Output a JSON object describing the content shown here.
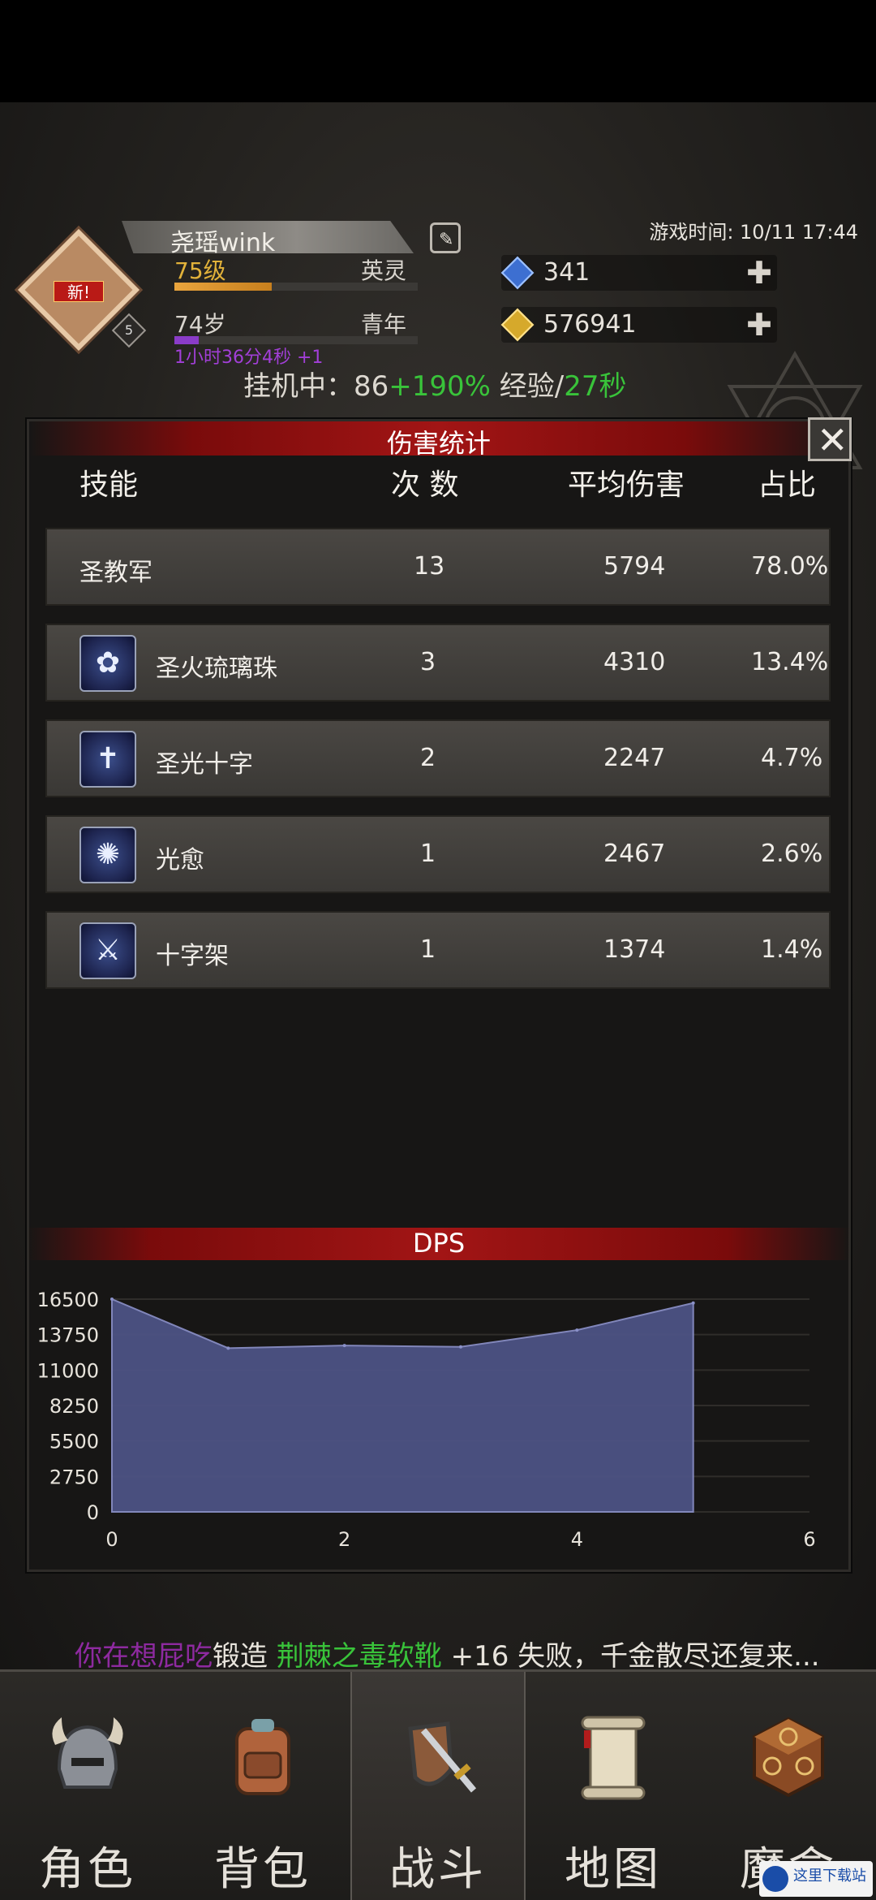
{
  "header": {
    "new_badge": "新!",
    "level_badge": "5",
    "player_name": "尧瑶wink",
    "level": "75级",
    "title1": "英灵",
    "age": "74岁",
    "title2": "青年",
    "bonus_time": "1小时36分4秒 +1",
    "game_time": "游戏时间: 10/11 17:44",
    "gems": "341",
    "gold": "576941",
    "idle_prefix": "挂机中：86",
    "idle_bonus": "+190%",
    "idle_mid": " 经验/",
    "idle_rate": "27秒",
    "exp_progress": 0.4,
    "age_progress": 0.1
  },
  "dialog": {
    "title": "伤害统计",
    "columns": [
      "技能",
      "次 数",
      "平均伤害",
      "占比"
    ],
    "rows": [
      {
        "name": "圣教军",
        "count": "13",
        "avg": "5794",
        "pct": "78.0%",
        "icon": ""
      },
      {
        "name": "圣火琉璃珠",
        "count": "3",
        "avg": "4310",
        "pct": "13.4%",
        "icon": "orb-icon"
      },
      {
        "name": "圣光十字",
        "count": "2",
        "avg": "2247",
        "pct": "4.7%",
        "icon": "cross-icon"
      },
      {
        "name": "光愈",
        "count": "1",
        "avg": "2467",
        "pct": "2.6%",
        "icon": "heal-icon"
      },
      {
        "name": "十字架",
        "count": "1",
        "avg": "1374",
        "pct": "1.4%",
        "icon": "sword-icon"
      }
    ]
  },
  "dps": {
    "title": "DPS"
  },
  "chart_data": {
    "type": "area",
    "title": "DPS",
    "x": [
      0,
      1,
      2,
      3,
      4,
      5
    ],
    "values": [
      16500,
      12700,
      12900,
      12800,
      14100,
      16200
    ],
    "xlim": [
      0,
      6
    ],
    "ylim": [
      0,
      16500
    ],
    "xticks": [
      "0",
      "2",
      "4",
      "6"
    ],
    "yticks": [
      "16500",
      "13750",
      "11000",
      "8250",
      "5500",
      "2750",
      "0"
    ],
    "fill_color": "#4e5487",
    "line_color": "#8a90c8"
  },
  "ticker": {
    "p1": "你在想屁吃",
    "p2": "锻造 ",
    "p3": "荆棘之毒软靴",
    "p4": " +16 失败，千金散尽还复来..."
  },
  "nav": [
    {
      "label": "角色",
      "icon": "helmet-icon"
    },
    {
      "label": "背包",
      "icon": "backpack-icon"
    },
    {
      "label": "战斗",
      "icon": "sword-shield-icon"
    },
    {
      "label": "地图",
      "icon": "scroll-map-icon"
    },
    {
      "label": "魔盒",
      "icon": "magic-box-icon"
    }
  ],
  "watermark": "这里下载站"
}
